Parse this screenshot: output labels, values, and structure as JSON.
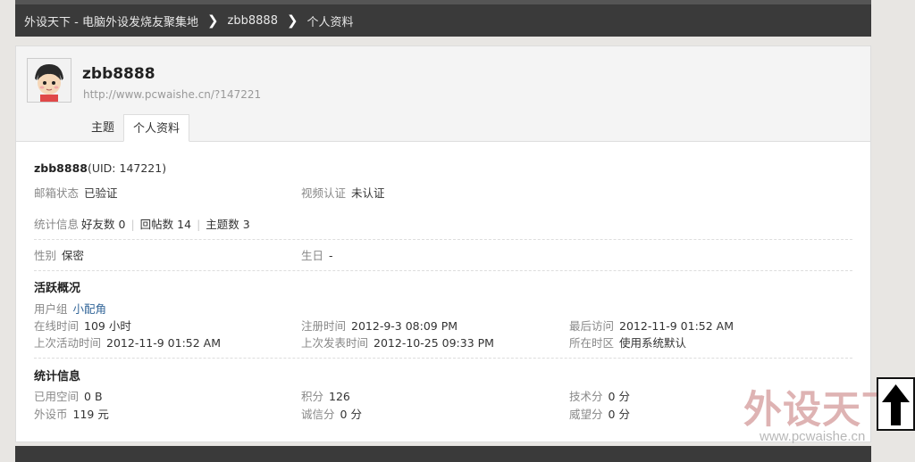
{
  "breadcrumb": {
    "items": [
      "外设天下 - 电脑外设发烧友聚集地",
      "zbb8888",
      "个人资料"
    ]
  },
  "profile": {
    "name": "zbb8888",
    "url": "http://www.pcwaishe.cn/?147221",
    "tabs": [
      "主题",
      "个人资料"
    ]
  },
  "info": {
    "name": "zbb8888",
    "uid": "(UID: 147221)",
    "email_label": "邮箱状态",
    "email_value": "已验证",
    "video_label": "视频认证",
    "video_value": "未认证",
    "stats_label": "统计信息",
    "friends": "好友数 0",
    "replies": "回帖数 14",
    "threads": "主题数 3",
    "gender_label": "性别",
    "gender_value": "保密",
    "birthday_label": "生日",
    "birthday_value": "-"
  },
  "activity": {
    "title": "活跃概况",
    "group_label": "用户组",
    "group_value": "小配角",
    "online_label": "在线时间",
    "online_value": "109 小时",
    "reg_label": "注册时间",
    "reg_value": "2012-9-3 08:09 PM",
    "last_visit_label": "最后访问",
    "last_visit_value": "2012-11-9 01:52 AM",
    "last_active_label": "上次活动时间",
    "last_active_value": "2012-11-9 01:52 AM",
    "last_post_label": "上次发表时间",
    "last_post_value": "2012-10-25 09:33 PM",
    "tz_label": "所在时区",
    "tz_value": "使用系统默认"
  },
  "statistics": {
    "title": "统计信息",
    "space_label": "已用空间",
    "space_value": "0 B",
    "points_label": "积分",
    "points_value": "126",
    "tech_label": "技术分",
    "tech_value": "0 分",
    "coin_label": "外设币",
    "coin_value": "119 元",
    "honest_label": "诚信分",
    "honest_value": "0 分",
    "prestige_label": "威望分",
    "prestige_value": "0 分"
  },
  "watermark": {
    "text": "外设天下",
    "url": "www.pcwaishe.cn"
  },
  "colors": {
    "header_bg": "#3a3a3a",
    "link": "#336699",
    "watermark": "#d9a6a6"
  }
}
